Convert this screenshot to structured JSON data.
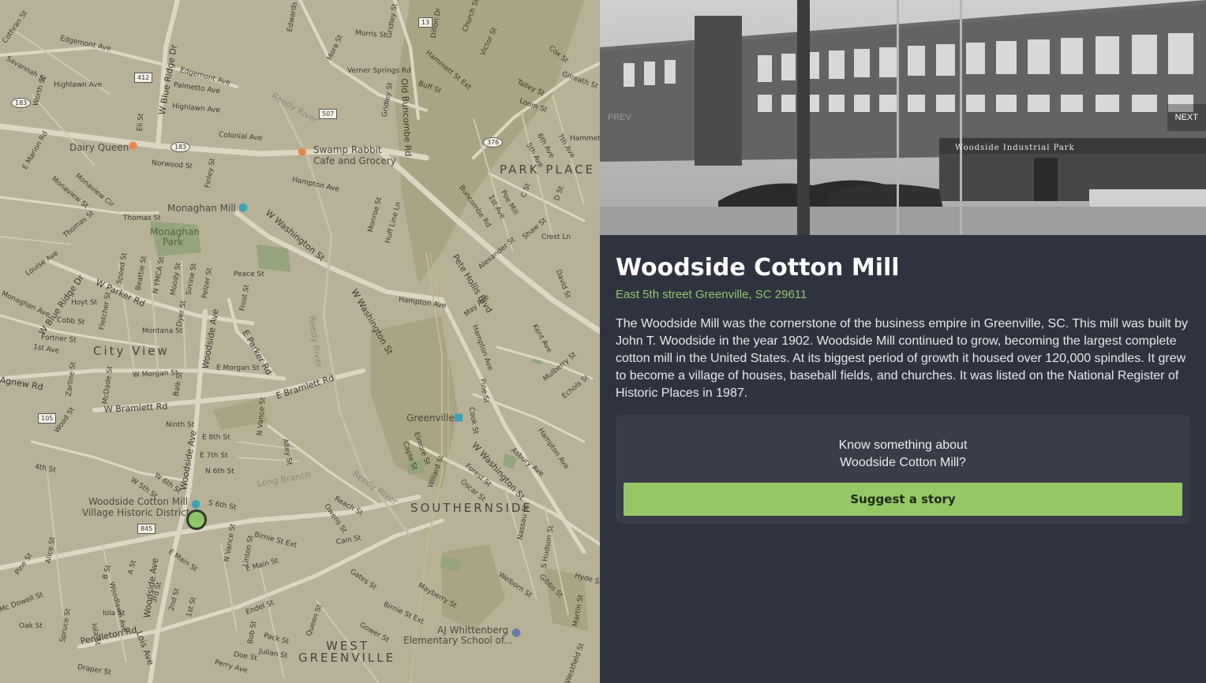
{
  "map": {
    "areas": {
      "park_place": "PARK PLACE",
      "city_view": "City View",
      "southernside": "SOUTHERNSIDE",
      "west_greenville_1": "WEST",
      "west_greenville_2": "GREENVILLE"
    },
    "pois": {
      "dairy_queen": "Dairy Queen",
      "swamp_rabbit_1": "Swamp Rabbit",
      "swamp_rabbit_2": "Cafe and Grocery",
      "monaghan_mill": "Monaghan Mill",
      "monaghan_park_1": "Monaghan",
      "monaghan_park_2": "Park",
      "greenville_station": "Greenville",
      "woodside_district_1": "Woodside Cotton Mill",
      "woodside_district_2": "Village Historic District",
      "aj_whittenberg_1": "AJ Whittenberg",
      "aj_whittenberg_2": "Elementary School of..."
    },
    "streets": {
      "w_blue_ridge_dr": "W Blue Ridge Dr",
      "w_blue_ridge_dr_2": "W Blue Ridge Dr",
      "edgemont_ave": "Edgemont Ave",
      "edgemont_ave_2": "Edgemont Ave",
      "highlawn_ave": "Highlawn Ave",
      "highlawn_ave_2": "Highlawn Ave",
      "palmetto_ave": "Palmetto Ave",
      "colonial_ave": "Colonial Ave",
      "norwood_st": "Norwood St",
      "hampton_ave": "Hampton Ave",
      "hampton_ave_2": "Hampton Ave",
      "hampton_ave_3": "Hampton Ave",
      "w_washington_st": "W Washington St",
      "w_washington_st_2": "W Washington St",
      "w_washington_st_3": "W Washington St",
      "w_parker_rd": "W Parker Rd",
      "e_parker_rd": "E Parker Rd",
      "woodside_ave": "Woodside Ave",
      "woodside_ave_2": "Woodside Ave",
      "woodside_ave_3": "Woodside Ave",
      "e_bramlett_rd": "E Bramlett Rd",
      "w_bramlett_rd": "W Bramlett Rd",
      "pete_hollis_blvd": "Pete Hollis Blvd",
      "old_buncombe_rd": "Old Buncombe Rd",
      "buncombe_rd": "Buncombe Rd",
      "reedy_river": "Reedy River",
      "reedy_river_2": "Reedy River",
      "reedy_river_3": "Reedy River",
      "long_branch": "Long Branch",
      "pendleton_rd": "Pendleton Rd",
      "lois_ave": "Lois Ave",
      "agnew_rd": "Agnew Rd",
      "e_morgan_st": "E Morgan St",
      "w_morgan_st": "W Morgan St",
      "montana_st": "Montana St",
      "ninth_st": "Ninth St",
      "e_8th_st": "E 8th St",
      "e_7th_st": "E 7th St",
      "n_6th_st": "N 6th St",
      "s_6th_st": "S 6th St",
      "w_6th_st": "W 6th St",
      "w_5th_st": "W 5th St",
      "e_main_st": "E Main St",
      "e_main_st_2": "E Main St",
      "birnie_st_ext": "Birnie St Ext",
      "birnie_st_ext_2": "Birnie St Ext",
      "cain_st": "Cain St",
      "gates_st": "Gates St",
      "mayberry_st": "Mayberry St",
      "welborn_st": "Welborn St",
      "gower_st": "Gower St",
      "endel_st": "Endel St",
      "peace_st": "Peace St",
      "thomas_st": "Thomas St",
      "thomas_st_2": "Thomas St",
      "crest_ln": "Crest Ln",
      "echols_st": "Echols St",
      "mulberry_st": "Mulberry St",
      "asbury_ave": "Asbury Ave",
      "forest_st": "Forest St",
      "oscar_st": "Oscar St",
      "hampton_ave_4": "Hampton Ave",
      "morris_st": "Morris St",
      "verner_springs_rd": "Verner Springs Rd",
      "buff_st": "Buff St",
      "talley_st": "Talley St",
      "loom_st": "Loom St",
      "gilreath_st": "Gilreath St",
      "mora_st": "Mora St",
      "oak_st": "Oak St",
      "mc_dowell_st": "Mc Dowell St",
      "pine_st": "Pine St",
      "cobb_st": "Cobb St",
      "hoyt_st": "Hoyt St",
      "fortner_st": "Fortner St",
      "first_ave": "1st Ave",
      "monaghan_ave": "Monaghan Ave",
      "louise_ave": "Louise Ave",
      "e_marion_rd": "E Marion Rd",
      "monaview_st": "Monaview St",
      "monaview_cir": "Monaview Cir",
      "worth_st": "Worth St",
      "savannah_st": "Savannah St",
      "cothran_st": "Cothran St",
      "zarline_st": "Zarline St",
      "mcdade_st": "McDade St",
      "wood_st": "Wood St",
      "fourth_st": "4th St",
      "reach_st": "Reach St",
      "owens_st": "Owens St",
      "linton_st": "Linton St",
      "n_vance_st": "N Vance St",
      "n_vance_st_2": "N Vance St",
      "alley_st": "Alley St",
      "willard_st": "Willard St",
      "cook_st": "Cook St",
      "pine_st_2": "Pine St",
      "nassau_st": "Nassau St",
      "s_hudson_st": "S Hudson St",
      "gibbs_st": "Gibbs St",
      "hyde_st": "Hyde St",
      "martin_st": "Martin St",
      "westfield_st": "Westfield St",
      "queen_st": "Queen St",
      "pack_st": "Pack St",
      "julian_st": "Julian St",
      "bob_st": "Bob St",
      "doe_st": "Doe St",
      "perry_ave": "Perry Ave",
      "draper_st": "Draper St",
      "spruce_st": "Spruce St",
      "alice_st": "Alice St",
      "iola_st": "Iola St",
      "iola_st_2": "Iola St",
      "woodlawn_ave": "Woodlawn Ave",
      "b_st": "B St",
      "a_st": "A St",
      "third_st": "3rd St",
      "second_st": "2nd St",
      "first_st": "1st St",
      "pendleton_2": "Pendleton Rd",
      "dyer_st": "Dyer St",
      "frost_st": "Frost St",
      "sirrine_st": "Sirrine St",
      "pelzer_st": "Pelzer St",
      "moody_st": "Moody St",
      "ymca_st": "N YMCA St",
      "beattie_st": "Beattie St",
      "speed_st": "Speed St",
      "fletcher_st": "Fletcher St",
      "finley_st": "Finley St",
      "eli_st": "Eli St",
      "monroe_st": "Monroe St",
      "huff_line_ln": "Huff Line Ln",
      "alexander_st": "Alexander St",
      "may_ave": "May Ave",
      "kent_ave": "Kent Ave",
      "david_st": "David St",
      "shaw_st": "Shaw St",
      "poe_mill": "Poe Mill",
      "c_st": "C St",
      "d_st": "D St",
      "first_ave_2": "1st Ave",
      "fifth_ave": "5th Ave",
      "sixth_ave": "6th Ave",
      "seventh_ave": "7th Ave",
      "hammett_st": "Hammett St",
      "hammett_st_ext": "Hammett St Ext",
      "cox_st": "Cox St",
      "victor_st": "Victor St",
      "church_st": "Church St",
      "dillon_dr": "Dillon Dr",
      "gridley_st": "Gridley St",
      "gridley_st_2": "Gridley St",
      "edwards_st": "Edwards St",
      "elmore_st": "Elmore St",
      "caple_st": "Caple St",
      "balk_st": "Balk St"
    },
    "shields": {
      "r412": "412",
      "r183a": "183",
      "r183b": "183",
      "r507": "507",
      "r376": "376",
      "r13": "13",
      "r105": "105",
      "r845": "845"
    }
  },
  "photo": {
    "sign_text": "Woodside Industrial Park",
    "prev_label": "PREV",
    "next_label": "NEXT"
  },
  "detail": {
    "title": "Woodside Cotton Mill",
    "address": "East 5th street Greenville, SC 29611",
    "description": "The Woodside Mill was the cornerstone of the business empire in Greenville, SC. This mill was built by John T. Woodside in the year 1902. Woodside Mill continued to grow, becoming the largest complete cotton mill in the United States. At its biggest period of growth it housed over 120,000 spindles. It grew to become a village of houses, baseball fields, and churches. It was listed on the National Register of Historic Places in 1987.",
    "card": {
      "prompt_line1": "Know something about",
      "prompt_line2": "Woodside Cotton Mill?",
      "button_label": "Suggest a story"
    }
  },
  "colors": {
    "panel_bg": "#2f3340",
    "card_bg": "#393d4a",
    "accent_green": "#95c864",
    "address_green": "#8fc66a",
    "map_bg": "#b7b197",
    "map_road": "#dcd7c2"
  }
}
